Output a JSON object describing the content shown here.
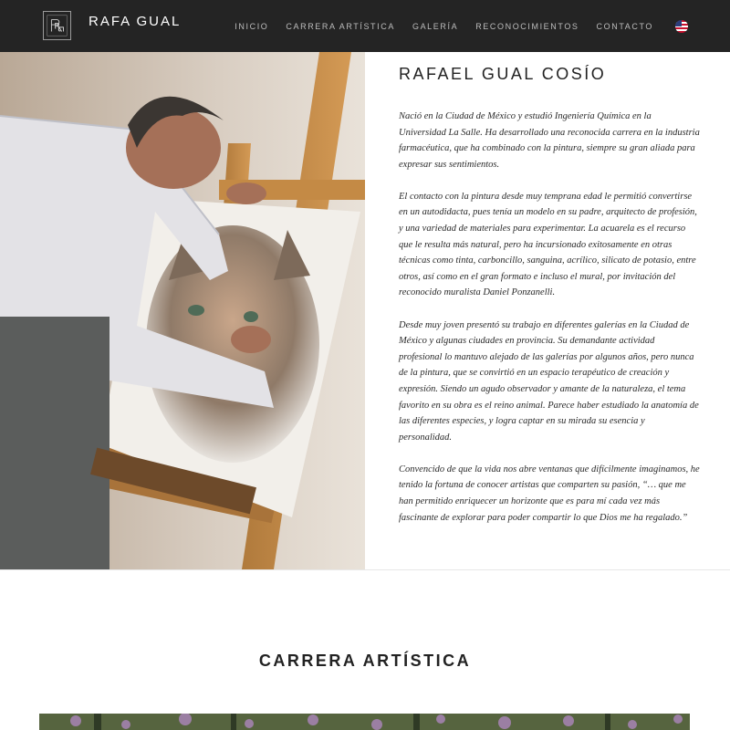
{
  "header": {
    "brand": "RAFA GUAL",
    "logo_icon": "rg-monogram-icon",
    "nav": [
      {
        "label": "INICIO"
      },
      {
        "label": "CARRERA ARTÍSTICA"
      },
      {
        "label": "GALERÍA"
      },
      {
        "label": "RECONOCIMIENTOS"
      },
      {
        "label": "CONTACTO"
      }
    ],
    "language_icon": "us-flag-icon"
  },
  "about": {
    "title": "RAFAEL GUAL COSÍO",
    "paragraphs": [
      "Nació en la Ciudad de México y estudió Ingeniería Química en la Universidad La Salle. Ha desarrollado una reconocida carrera en la industria farmacéutica, que ha combinado con la pintura, siempre su gran aliada para expresar sus sentimientos.",
      "El contacto con la pintura desde muy temprana edad le permitió convertirse en un autodidacta, pues tenía un modelo en su padre, arquitecto de profesión, y una variedad de materiales para experimentar. La acuarela es el recurso que le resulta más natural, pero ha incursionado exitosamente en otras técnicas como tinta, carboncillo, sanguina, acrílico, silicato de potasio, entre otros, así como en el gran formato e incluso el mural, por invitación del reconocido muralista Daniel Ponzanelli.",
      "Desde muy joven presentó su trabajo en diferentes galerías en la Ciudad de México y algunas ciudades en provincia. Su demandante actividad profesional lo mantuvo alejado de las galerías por algunos años, pero nunca de la pintura, que se convirtió en un espacio terapéutico de creación y expresión. Siendo un agudo observador y amante de la naturaleza, el tema favorito en su obra es el reino animal. Parece haber estudiado la anatomía de las diferentes especies, y logra captar en su mirada su esencia y personalidad.",
      "Convencido de que la vida nos abre ventanas que difícilmente imaginamos, he tenido la fortuna de conocer artistas que comparten su pasión, “… que me han permitido enriquecer un horizonte que es para mí cada vez más fascinante de explorar para poder compartir lo que Dios me ha regalado.”"
    ]
  },
  "career": {
    "title": "CARRERA ARTÍSTICA"
  },
  "colors": {
    "header_bg": "#242424",
    "nav_text": "#bdbdbd",
    "body_text": "#222222"
  }
}
